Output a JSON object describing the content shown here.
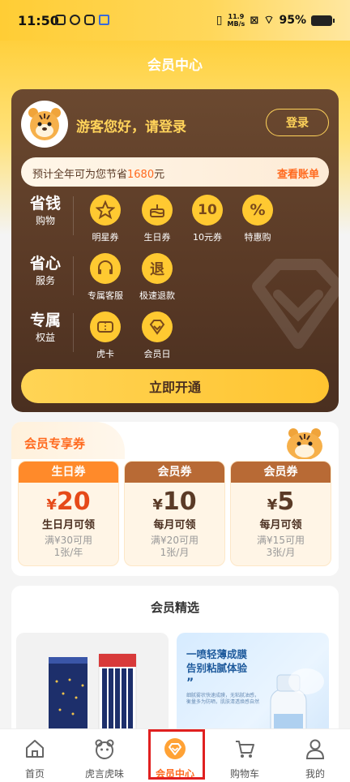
{
  "status_bar": {
    "time": "11:50",
    "net_speed": "11.9 MB/s",
    "battery": "95%"
  },
  "header": {
    "title": "会员中心"
  },
  "member_card": {
    "greeting": "游客您好，请登录",
    "login_label": "登录",
    "savings_prefix": "预计全年可为您节省",
    "savings_amount": "1680",
    "savings_suffix": "元",
    "view_bill_label": "查看账单",
    "categories": [
      {
        "big": "省钱",
        "small": "购物",
        "perks": [
          "明星券",
          "生日券",
          "10元券",
          "特惠购"
        ]
      },
      {
        "big": "省心",
        "small": "服务",
        "perks": [
          "专属客服",
          "极速退款"
        ]
      },
      {
        "big": "专属",
        "small": "权益",
        "perks": [
          "虎卡",
          "会员日"
        ]
      }
    ],
    "perk_icon_glyphs": {
      "ten": "10",
      "percent": "%",
      "refund": "退"
    },
    "open_label": "立即开通"
  },
  "coupons": {
    "title": "会员专享券",
    "currency": "¥",
    "items": [
      {
        "header": "生日券",
        "amount": "20",
        "line1": "生日月可领",
        "line2": "满¥30可用",
        "line3": "1张/年",
        "color": "#ff8a2a"
      },
      {
        "header": "会员券",
        "amount": "10",
        "line1": "每月可领",
        "line2": "满¥20可用",
        "line3": "1张/月",
        "color": "#b86a35"
      },
      {
        "header": "会员券",
        "amount": "5",
        "line1": "每月可领",
        "line2": "满¥15可用",
        "line3": "3张/月",
        "color": "#b86a35"
      }
    ]
  },
  "picks": {
    "title": "会员精选",
    "promo_headline_1": "一喷轻薄成膜",
    "promo_headline_2": "告别粘腻体验",
    "promo_quote": "”",
    "promo_desc": "细腻雾状快速成膜，无粘腻油感，衡量多为防晒，肌肤清透焕感自然"
  },
  "nav": {
    "items": [
      {
        "label": "首页",
        "icon": "home-icon"
      },
      {
        "label": "虎言虎味",
        "icon": "tiger-icon"
      },
      {
        "label": "会员中心",
        "icon": "diamond-icon"
      },
      {
        "label": "购物车",
        "icon": "cart-icon"
      },
      {
        "label": "我的",
        "icon": "profile-icon"
      }
    ],
    "active_index": 2
  },
  "colors": {
    "accent": "#ff6a1f",
    "gold": "#ffd35a",
    "card_brown": "#5a3a26",
    "highlight": "#e02020"
  }
}
